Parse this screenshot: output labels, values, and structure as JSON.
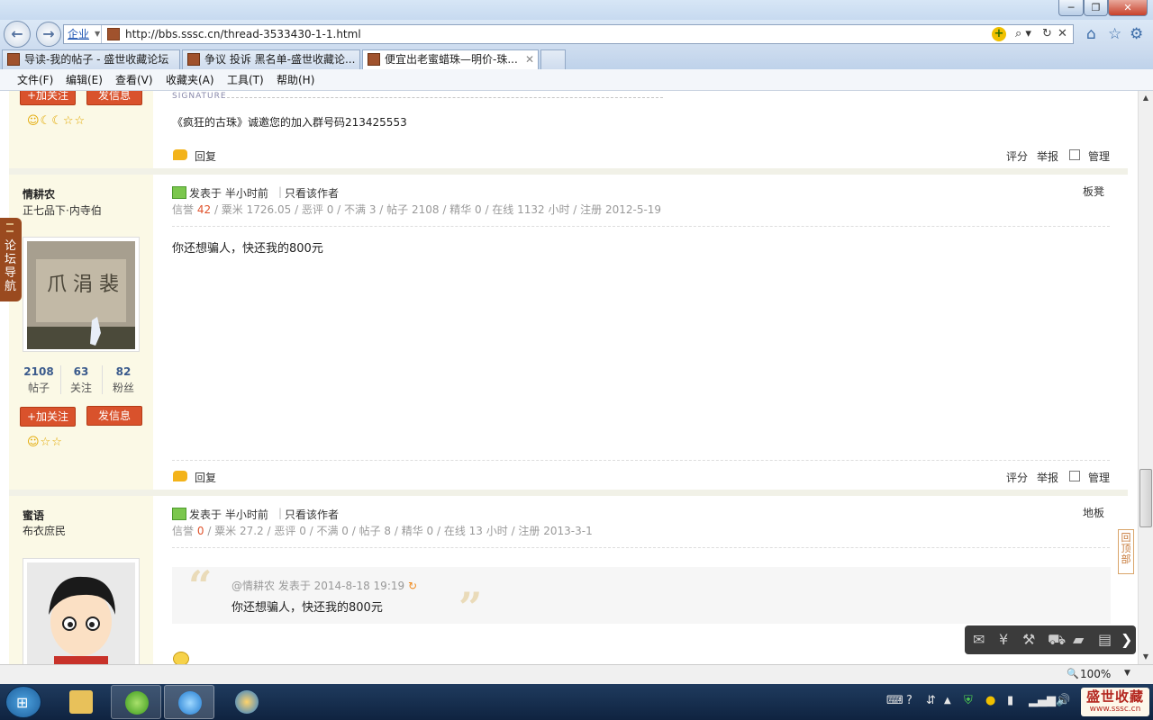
{
  "window": {
    "min_label": "─",
    "max_label": "❐",
    "close_label": "✕"
  },
  "nav": {
    "back": "←",
    "forward": "→"
  },
  "address": {
    "zone": "企业",
    "url": "http://bbs.sssc.cn/thread-3533430-1-1.html"
  },
  "tabs": [
    {
      "label": "导读-我的帖子 - 盛世收藏论坛"
    },
    {
      "label": "争议 投诉 黑名单-盛世收藏论..."
    },
    {
      "label": "便宜出老蜜蜡珠—明价-珠...",
      "close": "✕"
    }
  ],
  "menu": [
    "文件(F)",
    "编辑(E)",
    "查看(V)",
    "收藏夹(A)",
    "工具(T)",
    "帮助(H)"
  ],
  "side_nav": {
    "label": "论坛导航"
  },
  "common": {
    "follow": "+加关注",
    "message": "发信息",
    "reply": "回复",
    "rate": "评分",
    "report": "举报",
    "manage": "管理",
    "posted_at": "发表于 半小时前",
    "only_author": "只看该作者",
    "signature_label": "SIGNATURE"
  },
  "post0": {
    "signature": "《疯狂的古珠》诚邀您的加入群号码213425553",
    "icons": "☺☾☾☆☆"
  },
  "post1": {
    "username": "情耕农",
    "rank": "正七品下·内寺伯",
    "stats": [
      {
        "n": "2108",
        "l": "帖子"
      },
      {
        "n": "63",
        "l": "关注"
      },
      {
        "n": "82",
        "l": "粉丝"
      }
    ],
    "icons": "☺☆☆",
    "floor": "板凳",
    "meta_prefix": "信誉",
    "credit": "42",
    "meta_rest": "/ 粟米 1726.05 / 恶评 0 / 不满 3 / 帖子 2108 / 精华 0 / 在线 1132 小时 / 注册 2012-5-19",
    "body": "你还想骗人，快还我的800元"
  },
  "post2": {
    "username": "蜜语",
    "rank": "布衣庶民",
    "floor": "地板",
    "meta_prefix": "信誉",
    "credit": "0",
    "meta_rest": "/ 粟米 27.2 / 恶评 0 / 不满 0 / 帖子 8 / 精华 0 / 在线 13 小时 / 注册 2013-3-1",
    "quote_head": "@情耕农 发表于 2014-8-18 19:19",
    "quote_body": "你还想骗人，快还我的800元"
  },
  "back_to_top": "回顶部",
  "status": {
    "zoom": "100%"
  },
  "brand": {
    "name": "盛世收藏",
    "url": "www.sssc.cn"
  },
  "colors": {
    "accent": "#d9522c",
    "credit": "#e0522b",
    "sidebar_bg": "#fbf9e6"
  }
}
